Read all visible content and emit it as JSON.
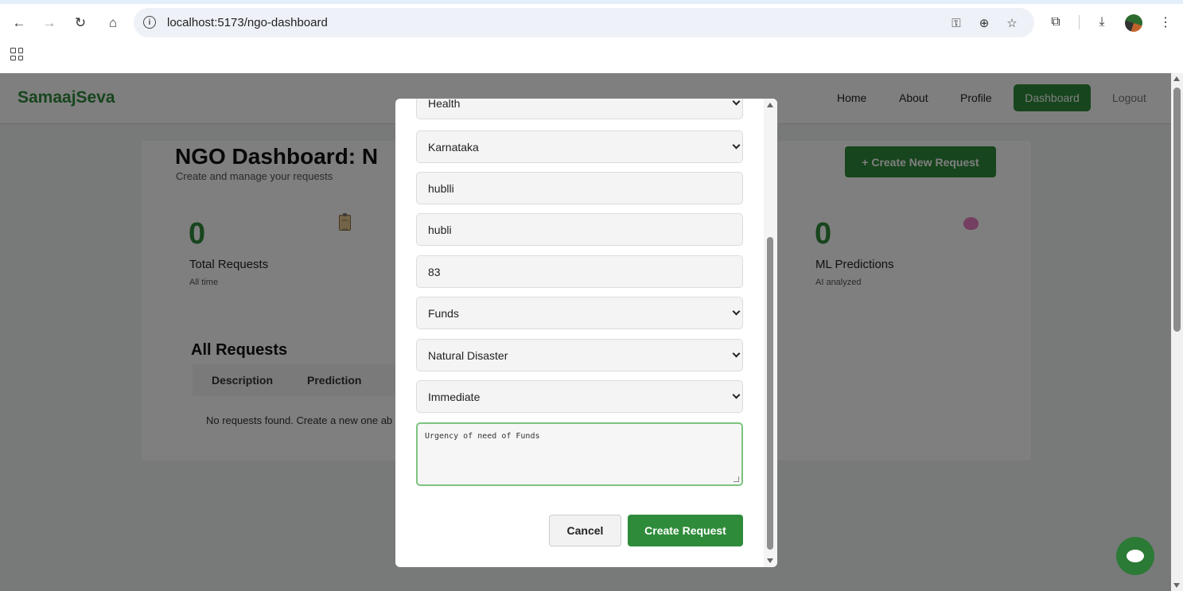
{
  "browser": {
    "url": "localhost:5173/ngo-dashboard"
  },
  "nav": {
    "brand": "SamaajSeva",
    "links": [
      "Home",
      "About",
      "Profile"
    ],
    "active": "Dashboard",
    "logout": "Logout"
  },
  "dashboard": {
    "title": "NGO Dashboard: N",
    "subtitle": "Create and manage your requests",
    "create_button": "+ Create New Request",
    "stats": [
      {
        "value": "0",
        "label": "Total Requests",
        "sub": "All time"
      },
      {
        "value": "0",
        "label": "ML Predictions",
        "sub": "AI analyzed"
      }
    ],
    "requests_title": "All Requests",
    "columns": [
      "Description",
      "Prediction"
    ],
    "empty_text": "No requests found. Create a new one ab"
  },
  "modal": {
    "fields": [
      "Health",
      "Karnataka",
      "hublli",
      "hubli",
      "83",
      "Funds",
      "Natural Disaster",
      "Immediate"
    ],
    "description": "Urgency of need of Funds",
    "cancel": "Cancel",
    "submit": "Create Request"
  },
  "colors": {
    "brand": "#2e8b3a"
  }
}
